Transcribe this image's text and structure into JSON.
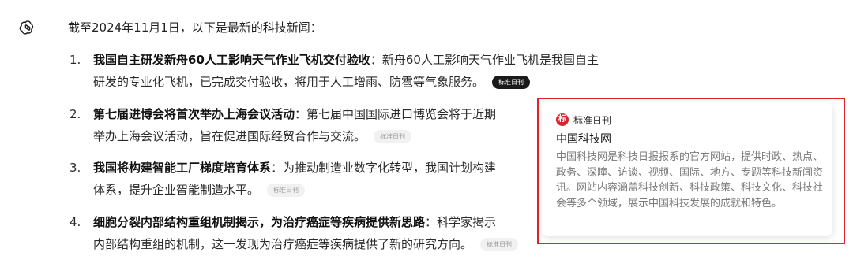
{
  "assistant": {
    "avatar_icon": "openai-logo-icon",
    "intro": "截至2024年11月1日，以下是最新的科技新闻："
  },
  "news": [
    {
      "number": "1.",
      "title": "我国自主研发新舟60人工影响天气作业飞机交付验收",
      "line1_rest": "：新舟60人工影响天气作业飞机是我国自主",
      "line2": "研发的专业化飞机，已完成交付验收，将用于人工增雨、防雹等气象服务。",
      "source": "标准日刊"
    },
    {
      "number": "2.",
      "title": "第七届进博会将首次举办上海会议活动",
      "line1_rest": "：第七届中国国际进口博览会将于近期",
      "line2": "举办上海会议活动，旨在促进国际经贸合作与交流。",
      "source": "标准日刊"
    },
    {
      "number": "3.",
      "title": "我国将构建智能工厂梯度培育体系",
      "line1_rest": "：为推动制造业数字化转型，我国计划构建",
      "line2": "体系，提升企业智能制造水平。",
      "source": "标准日刊"
    },
    {
      "number": "4.",
      "title": "细胞分裂内部结构重组机制揭示，为治疗癌症等疾病提供新思路",
      "line1_rest": "：科学家揭示",
      "line2": "内部结构重组的机制，这一发现为治疗癌症等疾病提供了新的研究方向。",
      "source": "标准日刊"
    }
  ],
  "hover_card": {
    "logo_icon": "standard-daily-logo-icon",
    "logo_glyph": "标",
    "source": "标准日刊",
    "title": "中国科技网",
    "description": "中国科技网是科技日报报系的官方网站，提供时政、热点、政务、深瞳、访谈、视频、国际、地方、专题等科技新闻资讯。网站内容涵盖科技创新、科技政策、科技文化、科技社会等多个领域，展示中国科技发展的成就和特色。"
  },
  "colors": {
    "highlight_border": "#e0242a",
    "badge_active_bg": "#1a1a1a",
    "logo_red": "#d9232d"
  }
}
